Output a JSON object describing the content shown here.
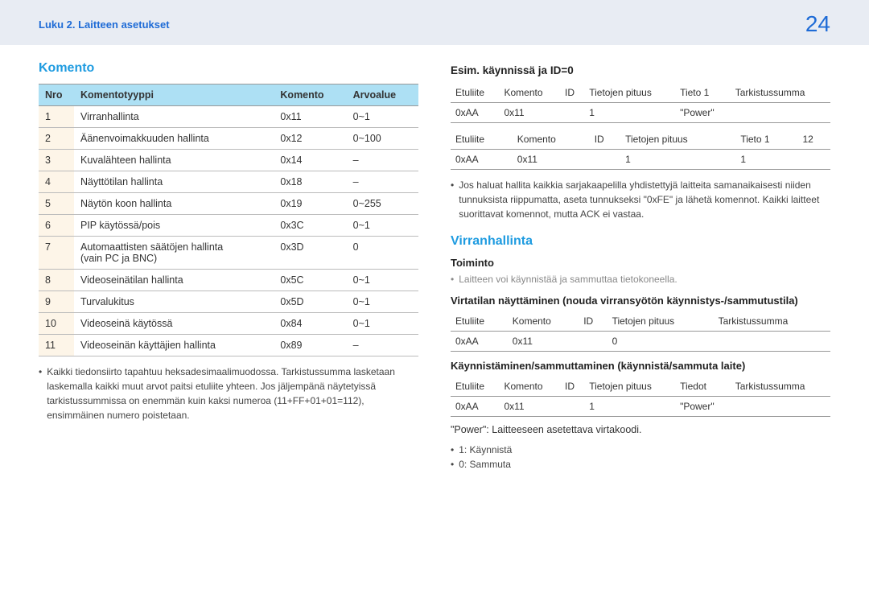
{
  "header": {
    "chapter": "Luku 2. Laitteen asetukset",
    "page_number": "24"
  },
  "left": {
    "heading": "Komento",
    "table_headers": {
      "c0": "Nro",
      "c1": "Komentotyyppi",
      "c2": "Komento",
      "c3": "Arvoalue"
    },
    "rows": [
      {
        "n": "1",
        "type": "Virranhallinta",
        "cmd": "0x11",
        "range": "0~1"
      },
      {
        "n": "2",
        "type": "Äänenvoimakkuuden hallinta",
        "cmd": "0x12",
        "range": "0~100"
      },
      {
        "n": "3",
        "type": "Kuvalähteen hallinta",
        "cmd": "0x14",
        "range": "–"
      },
      {
        "n": "4",
        "type": "Näyttötilan hallinta",
        "cmd": "0x18",
        "range": "–"
      },
      {
        "n": "5",
        "type": "Näytön koon hallinta",
        "cmd": "0x19",
        "range": "0~255"
      },
      {
        "n": "6",
        "type": "PIP käytössä/pois",
        "cmd": "0x3C",
        "range": "0~1"
      },
      {
        "n": "7",
        "type": "Automaattisten säätöjen hallinta\n(vain PC ja BNC)",
        "cmd": "0x3D",
        "range": "0"
      },
      {
        "n": "8",
        "type": "Videoseinätilan hallinta",
        "cmd": "0x5C",
        "range": "0~1"
      },
      {
        "n": "9",
        "type": "Turvalukitus",
        "cmd": "0x5D",
        "range": "0~1"
      },
      {
        "n": "10",
        "type": "Videoseinä käytössä",
        "cmd": "0x84",
        "range": "0~1"
      },
      {
        "n": "11",
        "type": "Videoseinän käyttäjien hallinta",
        "cmd": "0x89",
        "range": "–"
      }
    ],
    "footnote": "Kaikki tiedonsiirto tapahtuu heksadesimaalimuodossa. Tarkistussumma lasketaan laskemalla kaikki muut arvot paitsi etuliite yhteen. Jos jäljempänä näytetyissä tarkistussummissa on enemmän kuin kaksi numeroa (11+FF+01+01=112), ensimmäinen numero poistetaan."
  },
  "right": {
    "ex_heading": "Esim. käynnissä ja ID=0",
    "t1": {
      "h0": "Etuliite",
      "h1": "Komento",
      "h2": "ID",
      "h3": "Tietojen pituus",
      "h4": "Tieto 1",
      "h5": "Tarkistussumma",
      "r0": "0xAA",
      "r1": "0x11",
      "r2": "",
      "r3": "1",
      "r4": "\"Power\"",
      "r5": ""
    },
    "t2": {
      "h0": "Etuliite",
      "h1": "Komento",
      "h2": "ID",
      "h3": "Tietojen pituus",
      "h4": "Tieto 1",
      "h5": "12",
      "r0": "0xAA",
      "r1": "0x11",
      "r2": "",
      "r3": "1",
      "r4": "1",
      "r5": ""
    },
    "bullet_fe": "Jos haluat hallita kaikkia sarjakaapelilla yhdistettyjä laitteita samanaikaisesti niiden tunnuksista riippumatta, aseta tunnukseksi \"0xFE\" ja lähetä komennot. Kaikki laitteet suorittavat komennot, mutta ACK ei vastaa.",
    "power_heading": "Virranhallinta",
    "toiminto_label": "Toiminto",
    "toiminto_text": "Laitteen voi käynnistää ja sammuttaa tietokoneella.",
    "view_heading": "Virtatilan näyttäminen (nouda virransyötön käynnistys-/sammutustila)",
    "t3": {
      "h0": "Etuliite",
      "h1": "Komento",
      "h2": "ID",
      "h3": "Tietojen pituus",
      "h4": "Tarkistussumma",
      "r0": "0xAA",
      "r1": "0x11",
      "r2": "",
      "r3": "0",
      "r4": ""
    },
    "onoff_heading": "Käynnistäminen/sammuttaminen (käynnistä/sammuta laite)",
    "t4": {
      "h0": "Etuliite",
      "h1": "Komento",
      "h2": "ID",
      "h3": "Tietojen pituus",
      "h4": "Tiedot",
      "h5": "Tarkistussumma",
      "r0": "0xAA",
      "r1": "0x11",
      "r2": "",
      "r3": "1",
      "r4": "\"Power\"",
      "r5": ""
    },
    "power_code_label": "\"Power\": Laitteeseen asetettava virtakoodi.",
    "code_on": "1: Käynnistä",
    "code_off": "0: Sammuta"
  }
}
